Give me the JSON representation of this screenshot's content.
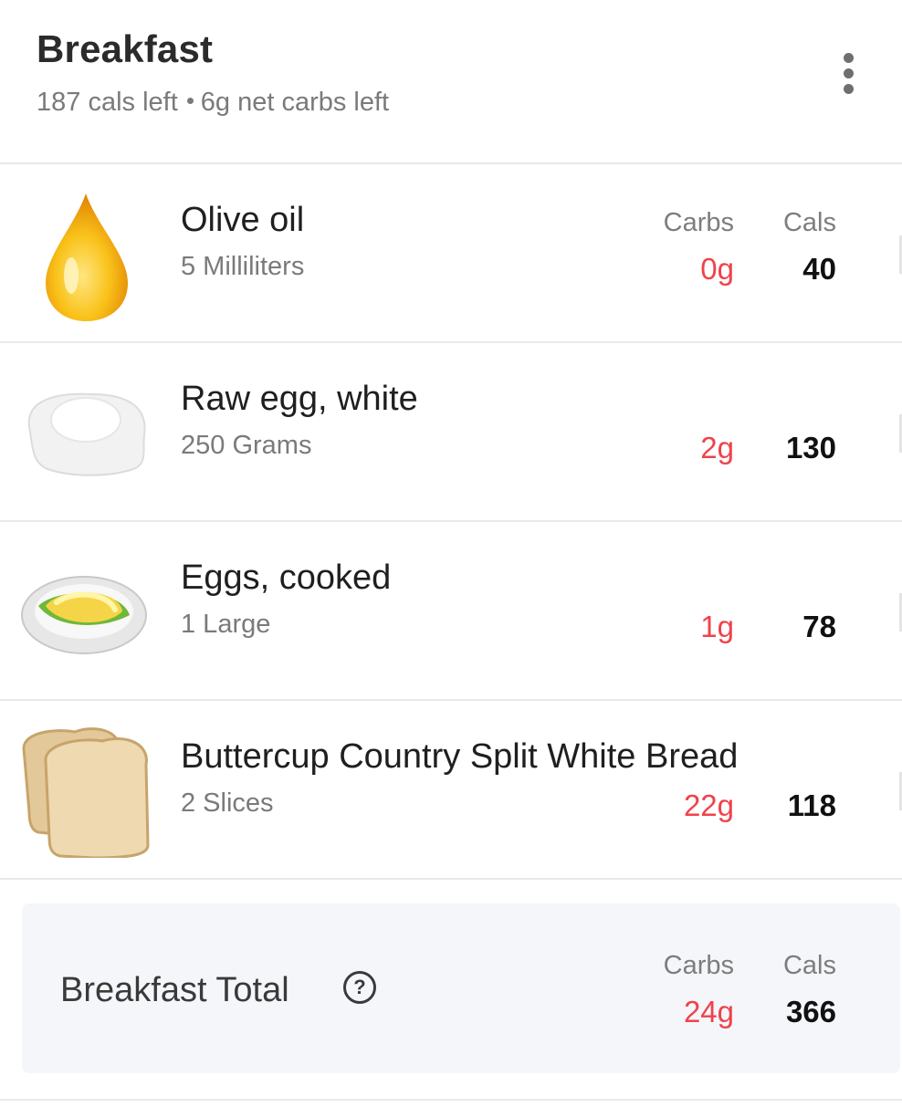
{
  "meal": {
    "title": "Breakfast",
    "cals_left": "187 cals left",
    "carbs_left": "6g net carbs left"
  },
  "columns": {
    "carbs": "Carbs",
    "cals": "Cals"
  },
  "items": [
    {
      "name": "Olive oil",
      "quantity": "5 Milliliters",
      "carbs": "0g",
      "cals": "40",
      "icon": "olive-oil-drop-icon"
    },
    {
      "name": "Raw egg, white",
      "quantity": "250 Grams",
      "carbs": "2g",
      "cals": "130",
      "icon": "egg-white-icon"
    },
    {
      "name": "Eggs, cooked",
      "quantity": "1 Large",
      "carbs": "1g",
      "cals": "78",
      "icon": "omelette-plate-icon"
    },
    {
      "name": "Buttercup Country Split White Bread",
      "quantity": "2 Slices",
      "carbs": "22g",
      "cals": "118",
      "icon": "bread-slices-icon"
    }
  ],
  "total": {
    "label": "Breakfast Total",
    "carbs": "24g",
    "cals": "366"
  },
  "colors": {
    "carbs": "#f0424a",
    "divider": "#e9e9e9",
    "total_bg": "#f4f6fa"
  }
}
